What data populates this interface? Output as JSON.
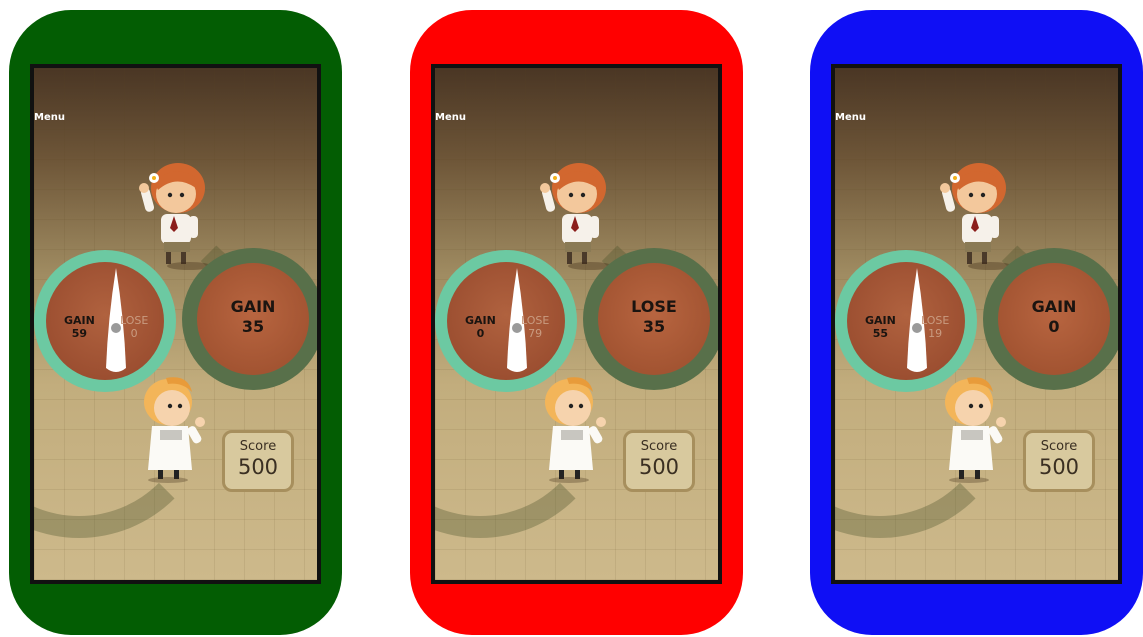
{
  "phones": [
    {
      "frame_color": "#035d03",
      "menu_label": "Menu",
      "wheel": {
        "gain_label": "GAIN",
        "gain_value": "59",
        "lose_label": "LOSE",
        "lose_value": "0"
      },
      "result": {
        "label": "GAIN",
        "value": "35"
      },
      "score": {
        "label": "Score",
        "value": "500"
      }
    },
    {
      "frame_color": "#ff0000",
      "menu_label": "Menu",
      "wheel": {
        "gain_label": "GAIN",
        "gain_value": "0",
        "lose_label": "LOSE",
        "lose_value": "79"
      },
      "result": {
        "label": "LOSE",
        "value": "35"
      },
      "score": {
        "label": "Score",
        "value": "500"
      }
    },
    {
      "frame_color": "#0f0ff5",
      "menu_label": "Menu",
      "wheel": {
        "gain_label": "GAIN",
        "gain_value": "55",
        "lose_label": "LOSE",
        "lose_value": "19"
      },
      "result": {
        "label": "GAIN",
        "value": "0"
      },
      "score": {
        "label": "Score",
        "value": "500"
      }
    }
  ],
  "icons": {
    "spinner_needle": "spinner-needle-icon",
    "girl_character": "girl-character-icon",
    "boy_character": "boy-character-icon"
  }
}
